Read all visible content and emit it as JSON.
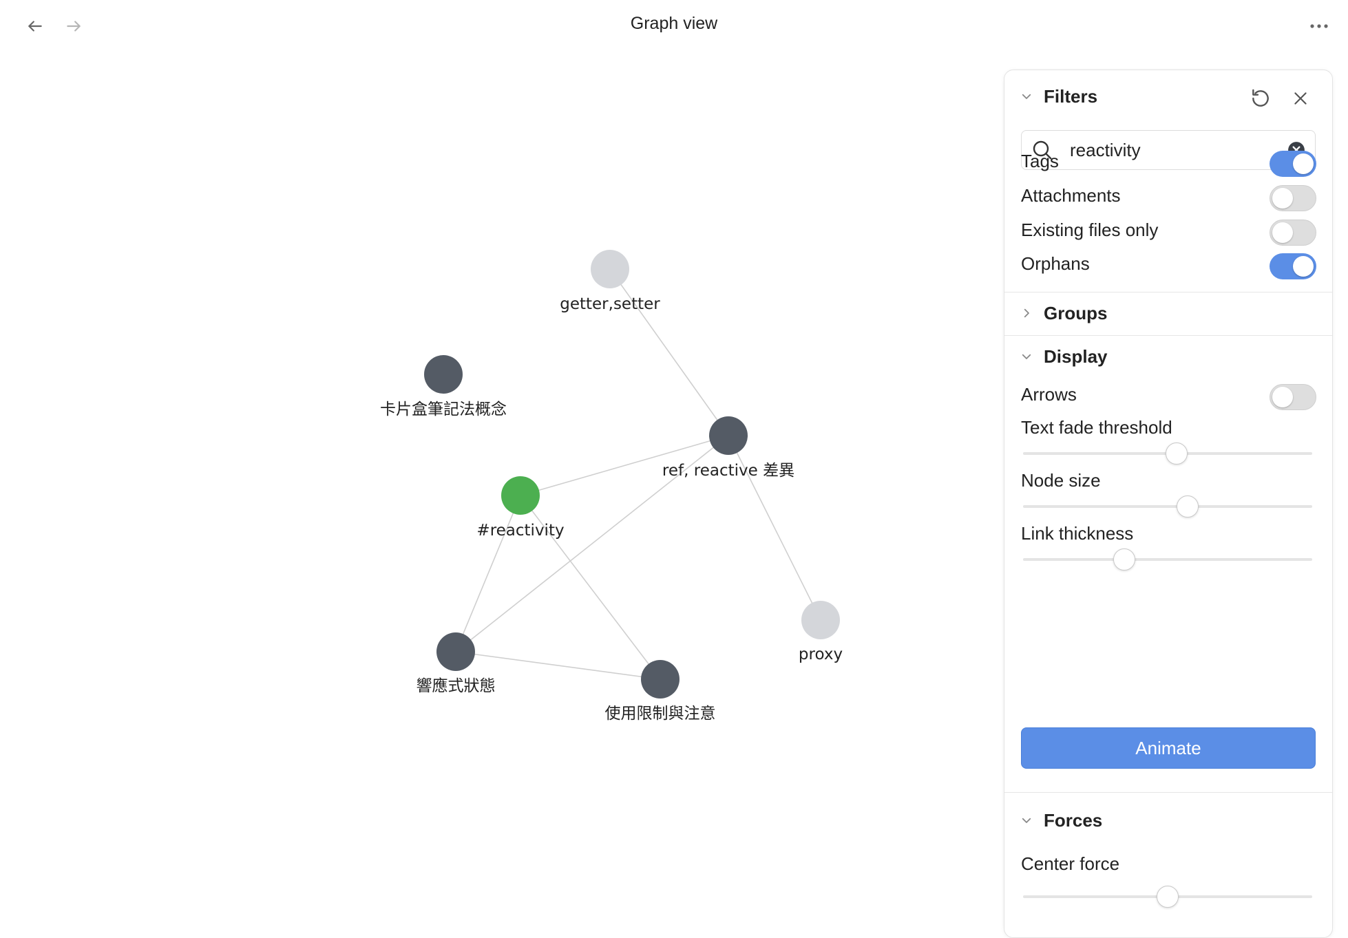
{
  "header": {
    "title": "Graph view",
    "back_icon": "arrow-left-icon",
    "forward_icon": "arrow-right-icon",
    "more_icon": "more-horizontal-icon"
  },
  "graph": {
    "nodes": [
      {
        "id": "getter-setter",
        "label": "getter,setter",
        "color": "#d4d6da"
      },
      {
        "id": "card-box",
        "label": "卡片盒筆記法概念",
        "color": "#545b65"
      },
      {
        "id": "ref-reactive",
        "label": "ref, reactive 差異",
        "color": "#545b65"
      },
      {
        "id": "reactivity-tag",
        "label": "#reactivity",
        "color": "#4caf50"
      },
      {
        "id": "proxy",
        "label": "proxy",
        "color": "#d4d6da"
      },
      {
        "id": "reactive-state",
        "label": "響應式狀態",
        "color": "#545b65"
      },
      {
        "id": "limitations",
        "label": "使用限制與注意",
        "color": "#545b65"
      }
    ],
    "edges": [
      [
        "getter-setter",
        "ref-reactive"
      ],
      [
        "ref-reactive",
        "reactivity-tag"
      ],
      [
        "ref-reactive",
        "reactive-state"
      ],
      [
        "ref-reactive",
        "proxy"
      ],
      [
        "reactivity-tag",
        "reactive-state"
      ],
      [
        "reactivity-tag",
        "limitations"
      ],
      [
        "reactive-state",
        "limitations"
      ]
    ],
    "edge_color": "#cfcfcf"
  },
  "filters": {
    "title": "Filters",
    "reset_icon": "reset-icon",
    "close_icon": "close-icon",
    "search": {
      "value": "reactivity",
      "icon": "search-icon",
      "clear_icon": "clear-icon"
    },
    "tags": {
      "label": "Tags",
      "on": true
    },
    "attachments": {
      "label": "Attachments",
      "on": false
    },
    "existing_files_only": {
      "label": "Existing files only",
      "on": false
    },
    "orphans": {
      "label": "Orphans",
      "on": true
    }
  },
  "groups": {
    "title": "Groups",
    "expanded": false
  },
  "display": {
    "title": "Display",
    "arrows": {
      "label": "Arrows",
      "on": false
    },
    "text_fade_threshold": {
      "label": "Text fade threshold",
      "value": 0.53
    },
    "node_size": {
      "label": "Node size",
      "value": 0.57
    },
    "link_thickness": {
      "label": "Link thickness",
      "value": 0.35
    },
    "animate_label": "Animate"
  },
  "forces": {
    "title": "Forces",
    "center_force": {
      "label": "Center force",
      "value": 0.5
    }
  },
  "colors": {
    "accent": "#5b8ee6",
    "tag_node": "#4caf50",
    "node_dark": "#545b65",
    "node_light": "#d4d6da"
  }
}
